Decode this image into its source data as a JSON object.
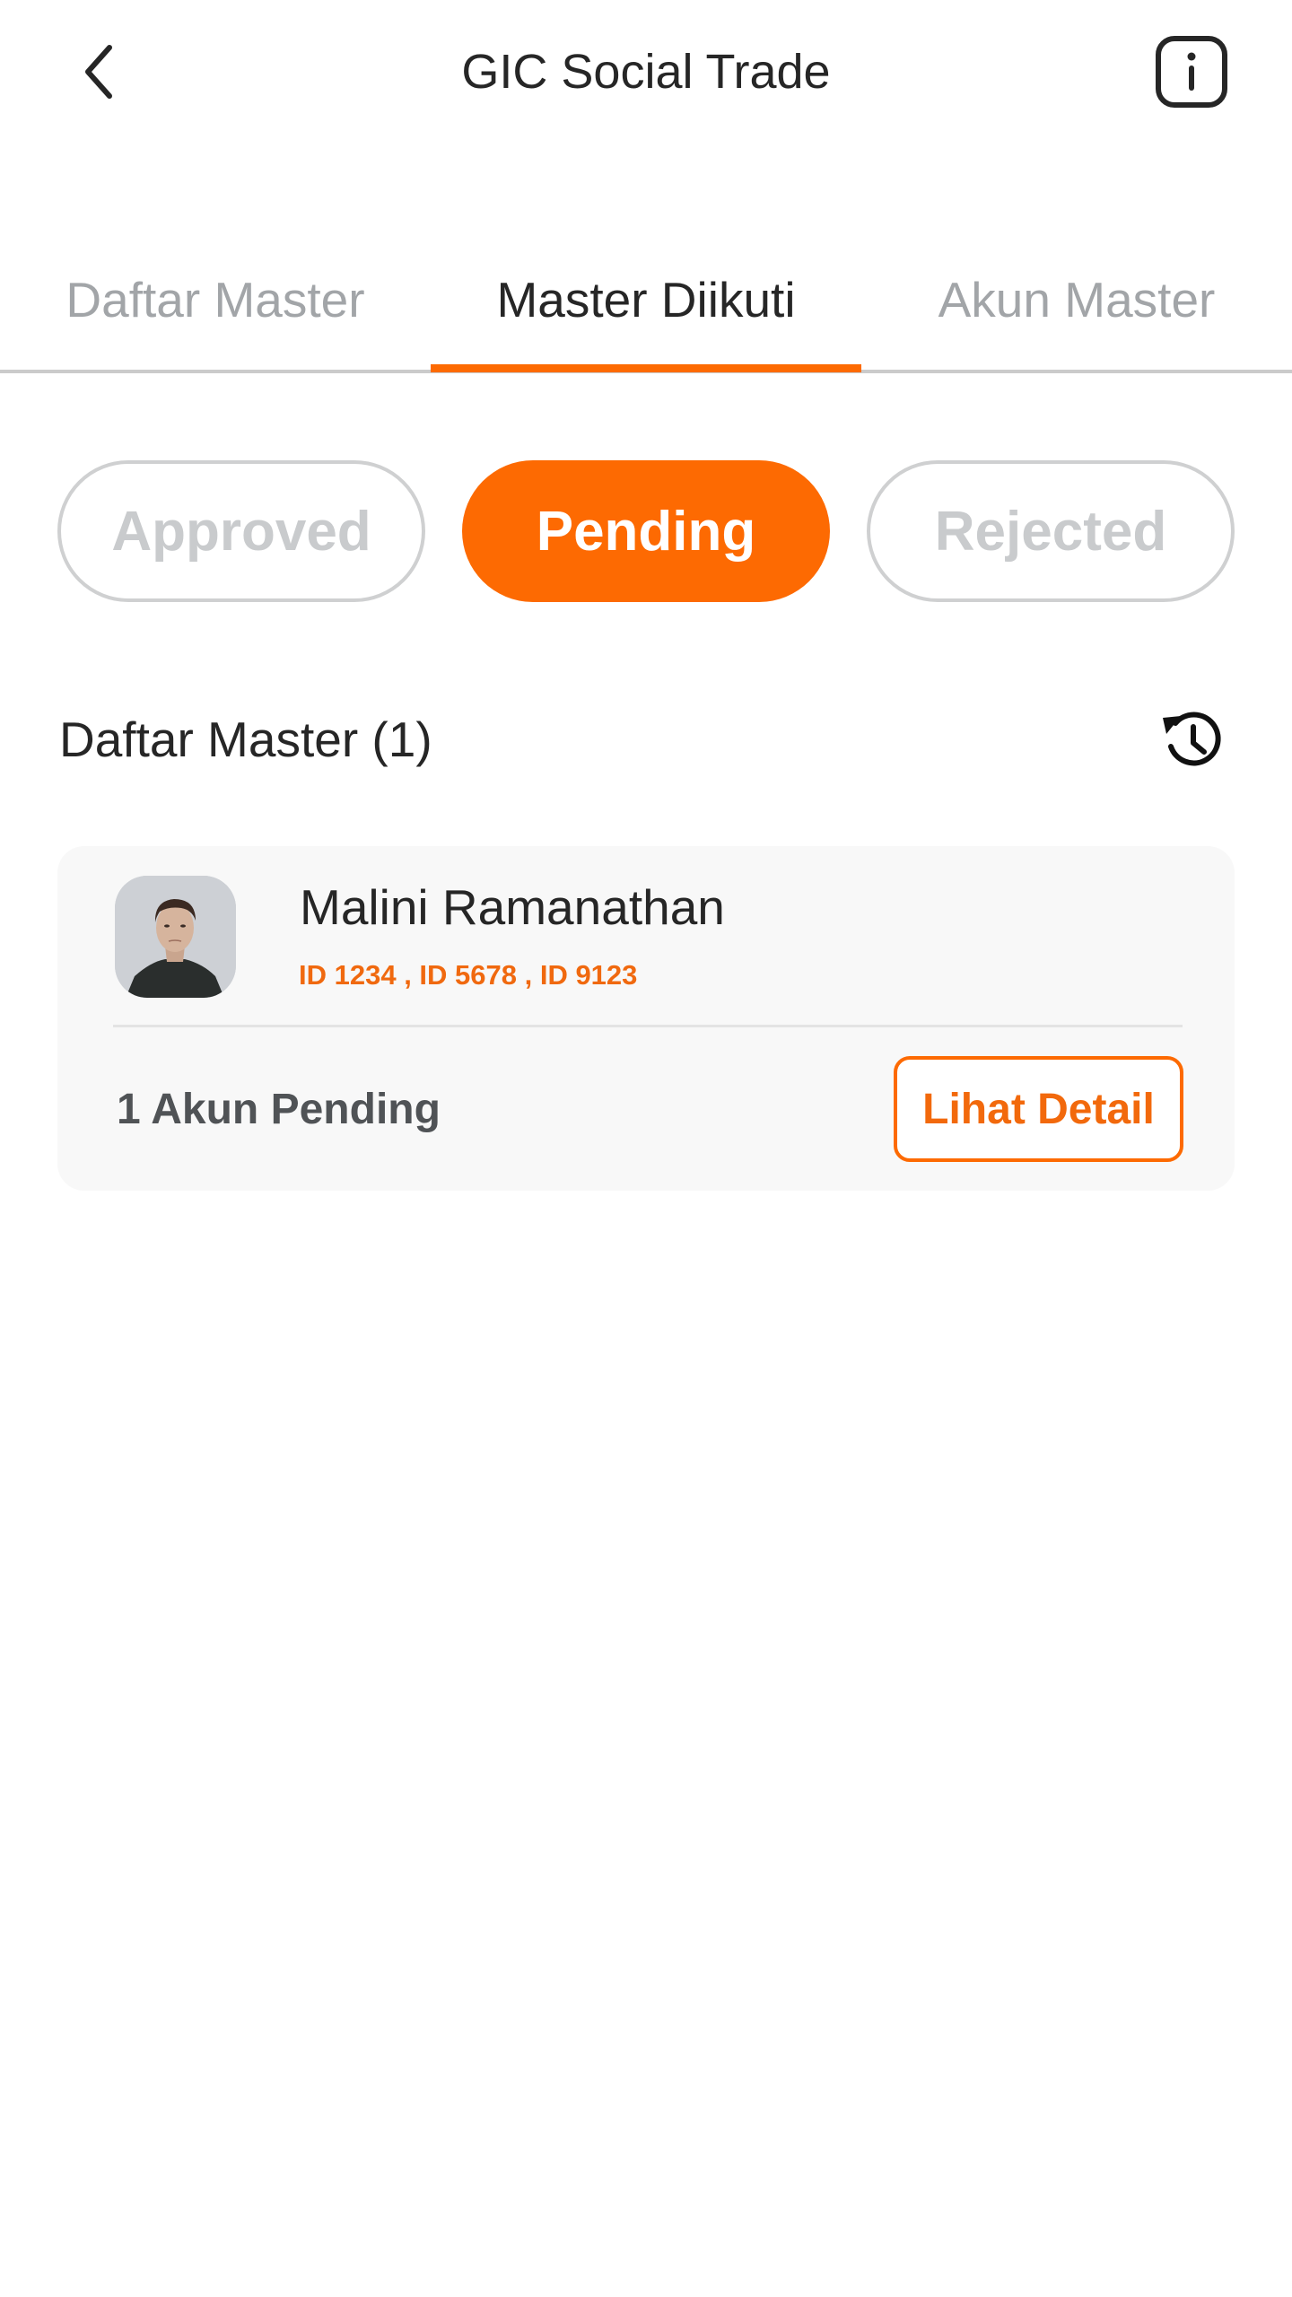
{
  "header": {
    "title": "GIC Social Trade",
    "back_icon": "chevron-left-icon",
    "info_icon": "info-icon"
  },
  "tabs": [
    {
      "label": "Daftar Master",
      "active": false
    },
    {
      "label": "Master Diikuti",
      "active": true
    },
    {
      "label": "Akun Master",
      "active": false
    }
  ],
  "status_filters": [
    {
      "label": "Approved",
      "active": false
    },
    {
      "label": "Pending",
      "active": true
    },
    {
      "label": "Rejected",
      "active": false
    }
  ],
  "section": {
    "title": "Daftar Master (1)",
    "history_icon": "history-icon"
  },
  "masters": [
    {
      "name": "Malini Ramanathan",
      "ids": "ID 1234 , ID 5678 , ID 9123",
      "pending_text": "1 Akun Pending",
      "detail_label": "Lihat Detail",
      "avatar_icon": "avatar-photo"
    }
  ],
  "colors": {
    "accent": "#fd6a02",
    "text_primary": "#262626",
    "text_muted": "#a2a5a8",
    "card_bg": "#f8f8f8"
  }
}
